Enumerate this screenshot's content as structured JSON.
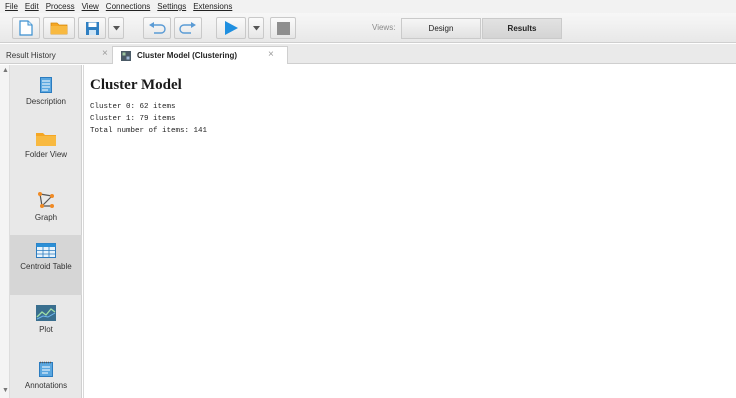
{
  "menu": [
    "File",
    "Edit",
    "Process",
    "View",
    "Connections",
    "Settings",
    "Extensions"
  ],
  "toolbar": {
    "icons": [
      "new-document-icon",
      "open-folder-icon",
      "save-icon",
      "dropdown-arrow-icon",
      "undo-icon",
      "redo-icon",
      "run-icon",
      "stop-icon"
    ],
    "views_label": "Views:",
    "view_design": "Design",
    "view_results": "Results"
  },
  "tabs": {
    "result_history": "Result History",
    "cluster_model": "Cluster Model (Clustering)",
    "close_glyph": "×"
  },
  "side": {
    "items": [
      {
        "label": "Description",
        "icon": "document-icon"
      },
      {
        "label": "Folder View",
        "icon": "folder-icon"
      },
      {
        "label": "Graph",
        "icon": "graph-icon"
      },
      {
        "label": "Centroid Table",
        "icon": "table-icon"
      },
      {
        "label": "Plot",
        "icon": "plot-icon"
      },
      {
        "label": "Annotations",
        "icon": "annotations-icon"
      }
    ]
  },
  "content": {
    "title": "Cluster Model",
    "lines": [
      "Cluster 0: 62 items",
      "Cluster 1: 79 items",
      "Total number of items: 141"
    ]
  },
  "colors": {
    "accent_blue": "#2b8fd6",
    "folder_orange": "#f5a623",
    "selected_bg": "#d6d6d6"
  }
}
